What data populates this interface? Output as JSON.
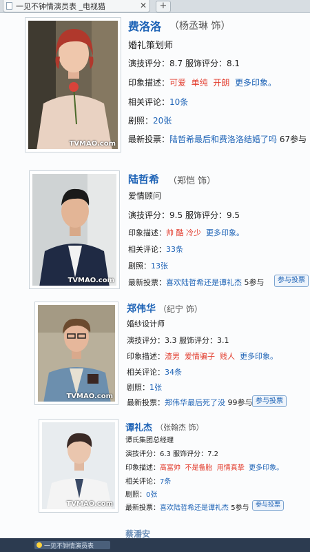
{
  "browser": {
    "tab_title": "一见不钟情演员表 _电视猫",
    "new_tab": "+",
    "close": "✕"
  },
  "watermark": "TVMAO.com",
  "labels": {
    "acting": "演技评分：",
    "costume": "服饰评分：",
    "impression": "印象描述：",
    "comments": "相关评论：",
    "stills": "剧照：",
    "latest_vote": "最新投票：",
    "vote_button": "参与投票",
    "more": "更多印象。"
  },
  "cast": [
    {
      "name": "费洛洛",
      "actor": "（杨丞琳 饰）",
      "role": "婚礼策划师",
      "acting": "8.7",
      "costume": "8.1",
      "tags": [
        "可爱",
        "单纯",
        "开朗"
      ],
      "comments": "10条",
      "stills": "20张",
      "vote": "陆哲希最后和费洛洛结婚了吗",
      "vote_count": "67参与"
    },
    {
      "name": "陆哲希",
      "actor": "（郑恺 饰）",
      "role": "爱情顾问",
      "acting": "9.5",
      "costume": "9.5",
      "tags": [
        "帅",
        "酷",
        "冷少"
      ],
      "comments": "33条",
      "stills": "13张",
      "vote": "喜欢陆哲希还是谭礼杰",
      "vote_count": "5参与"
    },
    {
      "name": "郑伟华",
      "actor": "（纪宁 饰）",
      "role": "婚纱设计师",
      "acting": "3.3",
      "costume": "3.1",
      "tags": [
        "渣男",
        "爱情骗子",
        "贱人"
      ],
      "comments": "34条",
      "stills": "1张",
      "vote": "郑伟华最后死了没",
      "vote_count": "99参与"
    },
    {
      "name": "谭礼杰",
      "actor": "（张翰杰 饰）",
      "role": "谭氏集团总经理",
      "acting": "6.3",
      "costume": "7.2",
      "tags": [
        "高富帅",
        "不是备胎",
        "用情真挚"
      ],
      "comments": "7条",
      "stills": "0张",
      "vote": "喜欢陆哲希还是谭礼杰",
      "vote_count": "5参与"
    }
  ],
  "next_name": "蔡潘安",
  "taskbar_label": "一见不钟情演员表"
}
